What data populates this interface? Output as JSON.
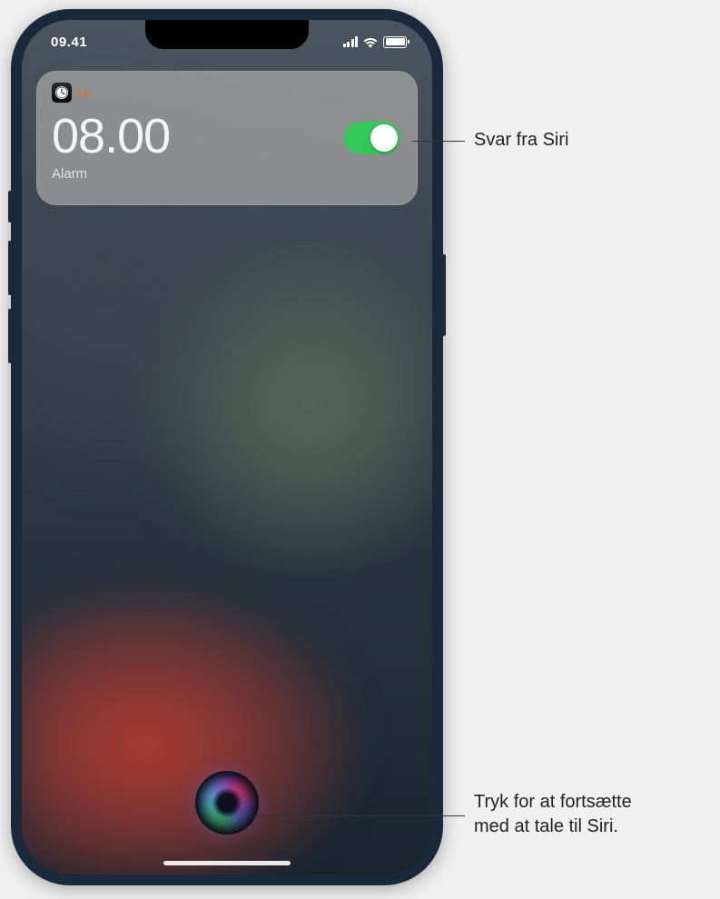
{
  "status_bar": {
    "time": "09.41"
  },
  "siri_response_card": {
    "app_name": "Ur",
    "alarm_time": "08.00",
    "label": "Alarm",
    "toggle_on": true
  },
  "callouts": {
    "top": "Svar fra Siri",
    "bottom_line1": "Tryk for at fortsætte",
    "bottom_line2": "med at tale til Siri."
  }
}
